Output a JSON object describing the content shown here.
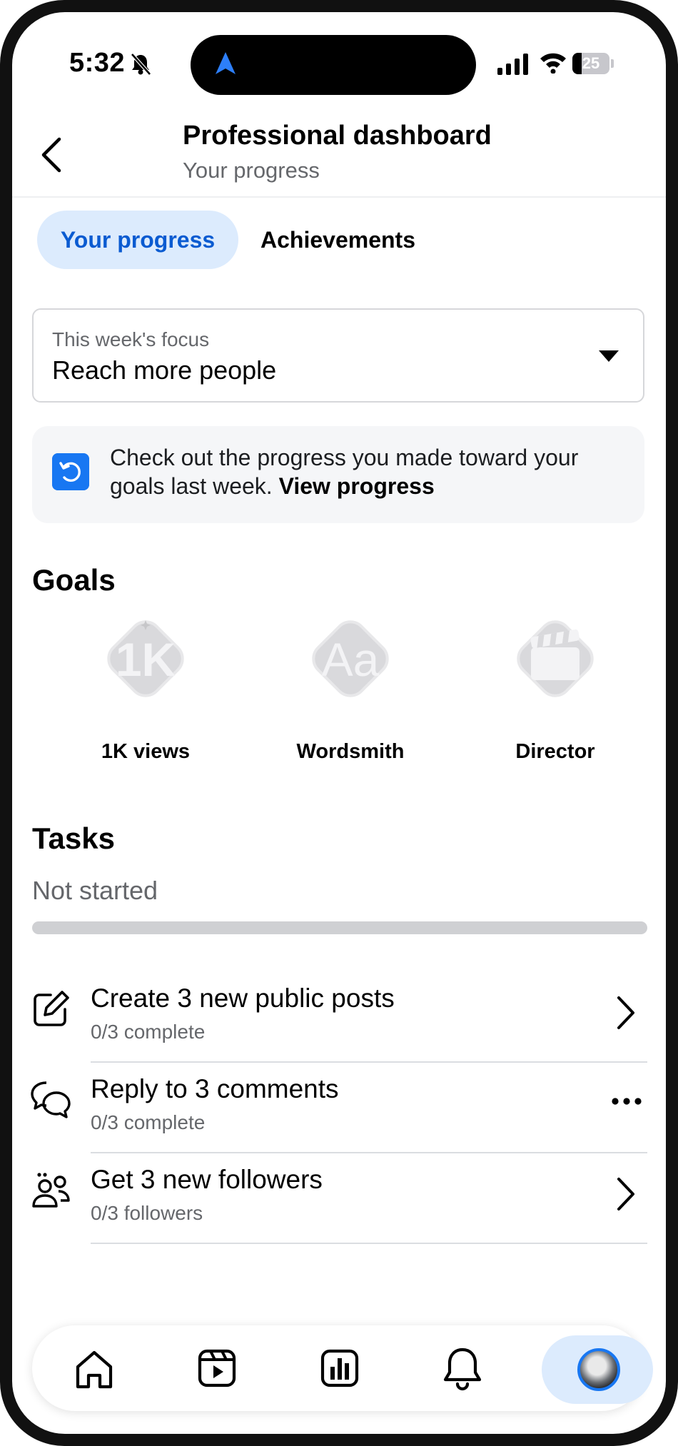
{
  "status_bar": {
    "time": "5:32",
    "battery": "25"
  },
  "header": {
    "title": "Professional dashboard",
    "subtitle": "Your progress"
  },
  "tabs": [
    {
      "label": "Your progress",
      "active": true
    },
    {
      "label": "Achievements",
      "active": false
    }
  ],
  "focus_dropdown": {
    "label": "This week's focus",
    "value": "Reach more people"
  },
  "info_card": {
    "text": "Check out the progress you made toward your goals last week.",
    "link": "View progress"
  },
  "goals": {
    "title": "Goals",
    "items": [
      {
        "label": "1K views",
        "icon": "1k-badge-icon"
      },
      {
        "label": "Wordsmith",
        "icon": "aa-badge-icon"
      },
      {
        "label": "Director",
        "icon": "clapperboard-badge-icon"
      }
    ]
  },
  "tasks": {
    "title": "Tasks",
    "status": "Not started",
    "progress": 0,
    "items": [
      {
        "title": "Create 3 new public posts",
        "subtitle": "0/3 complete",
        "icon": "edit-icon",
        "action": "chevron-right-icon"
      },
      {
        "title": "Reply to 3 comments",
        "subtitle": "0/3 complete",
        "icon": "comments-icon",
        "action": "more-icon"
      },
      {
        "title": "Get 3 new followers",
        "subtitle": "0/3 followers",
        "icon": "followers-icon",
        "action": "chevron-right-icon"
      }
    ]
  },
  "bottom_nav": [
    "home-icon",
    "reels-icon",
    "dashboard-icon",
    "notifications-icon",
    "profile-avatar"
  ],
  "colors": {
    "accent": "#1877f2",
    "tab_active_bg": "#dcebfd",
    "tab_active_text": "#0a5bd1",
    "muted_text": "#65676b"
  }
}
